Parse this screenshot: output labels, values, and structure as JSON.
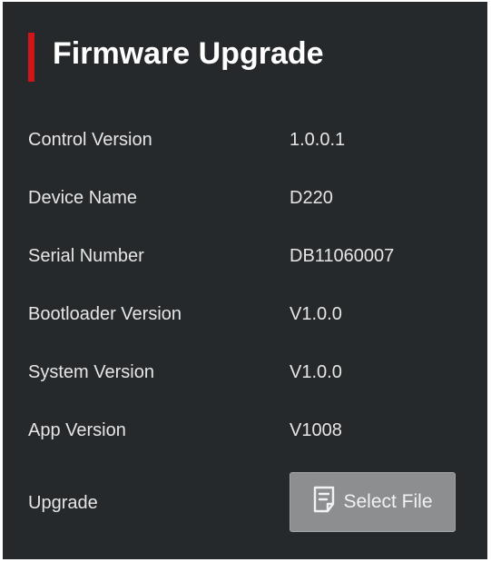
{
  "panel": {
    "title": "Firmware Upgrade",
    "accent_color": "#d0151a",
    "background_color": "#26292c"
  },
  "info_rows": [
    {
      "label": "Control Version",
      "value": "1.0.0.1"
    },
    {
      "label": "Device Name",
      "value": "D220"
    },
    {
      "label": "Serial Number",
      "value": "DB11060007"
    },
    {
      "label": "Bootloader Version",
      "value": "V1.0.0"
    },
    {
      "label": "System Version",
      "value": "V1.0.0"
    },
    {
      "label": "App Version",
      "value": "V1008"
    }
  ],
  "upgrade": {
    "label": "Upgrade",
    "button_label": "Select File",
    "button_icon": "document-icon"
  }
}
